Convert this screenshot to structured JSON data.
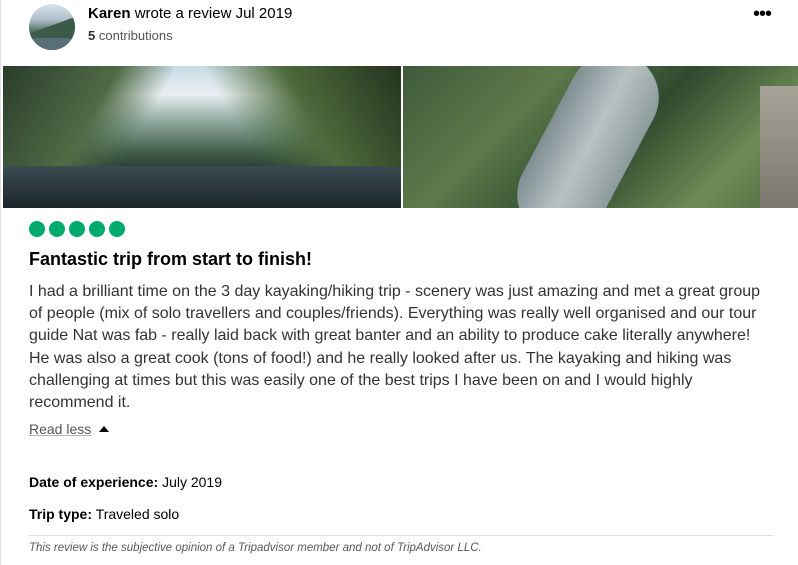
{
  "review": {
    "author": "Karen",
    "action_text": "wrote a review",
    "date": "Jul 2019",
    "contributions_count": "5",
    "contributions_label": "contributions",
    "more_icon": "•••",
    "rating_bubbles": 5,
    "rating_color": "#00aa6c",
    "title": "Fantastic trip from start to finish!",
    "body": "I had a brilliant time on the 3 day kayaking/hiking trip - scenery was just amazing and met a great group of people (mix of solo travellers and couples/friends). Everything was really well organised and our tour guide Nat was fab - really laid back with great banter and an ability to produce cake literally anywhere! He was also a great cook (tons of food!) and he really looked after us. The kayaking and hiking was challenging at times but this was easily one of the best trips I have been on and I would highly recommend it.",
    "read_less_label": "Read less",
    "date_of_experience_label": "Date of experience:",
    "date_of_experience_value": "July 2019",
    "trip_type_label": "Trip type:",
    "trip_type_value": "Traveled solo",
    "disclaimer": "This review is the subjective opinion of a Tripadvisor member and not of TripAdvisor LLC."
  }
}
